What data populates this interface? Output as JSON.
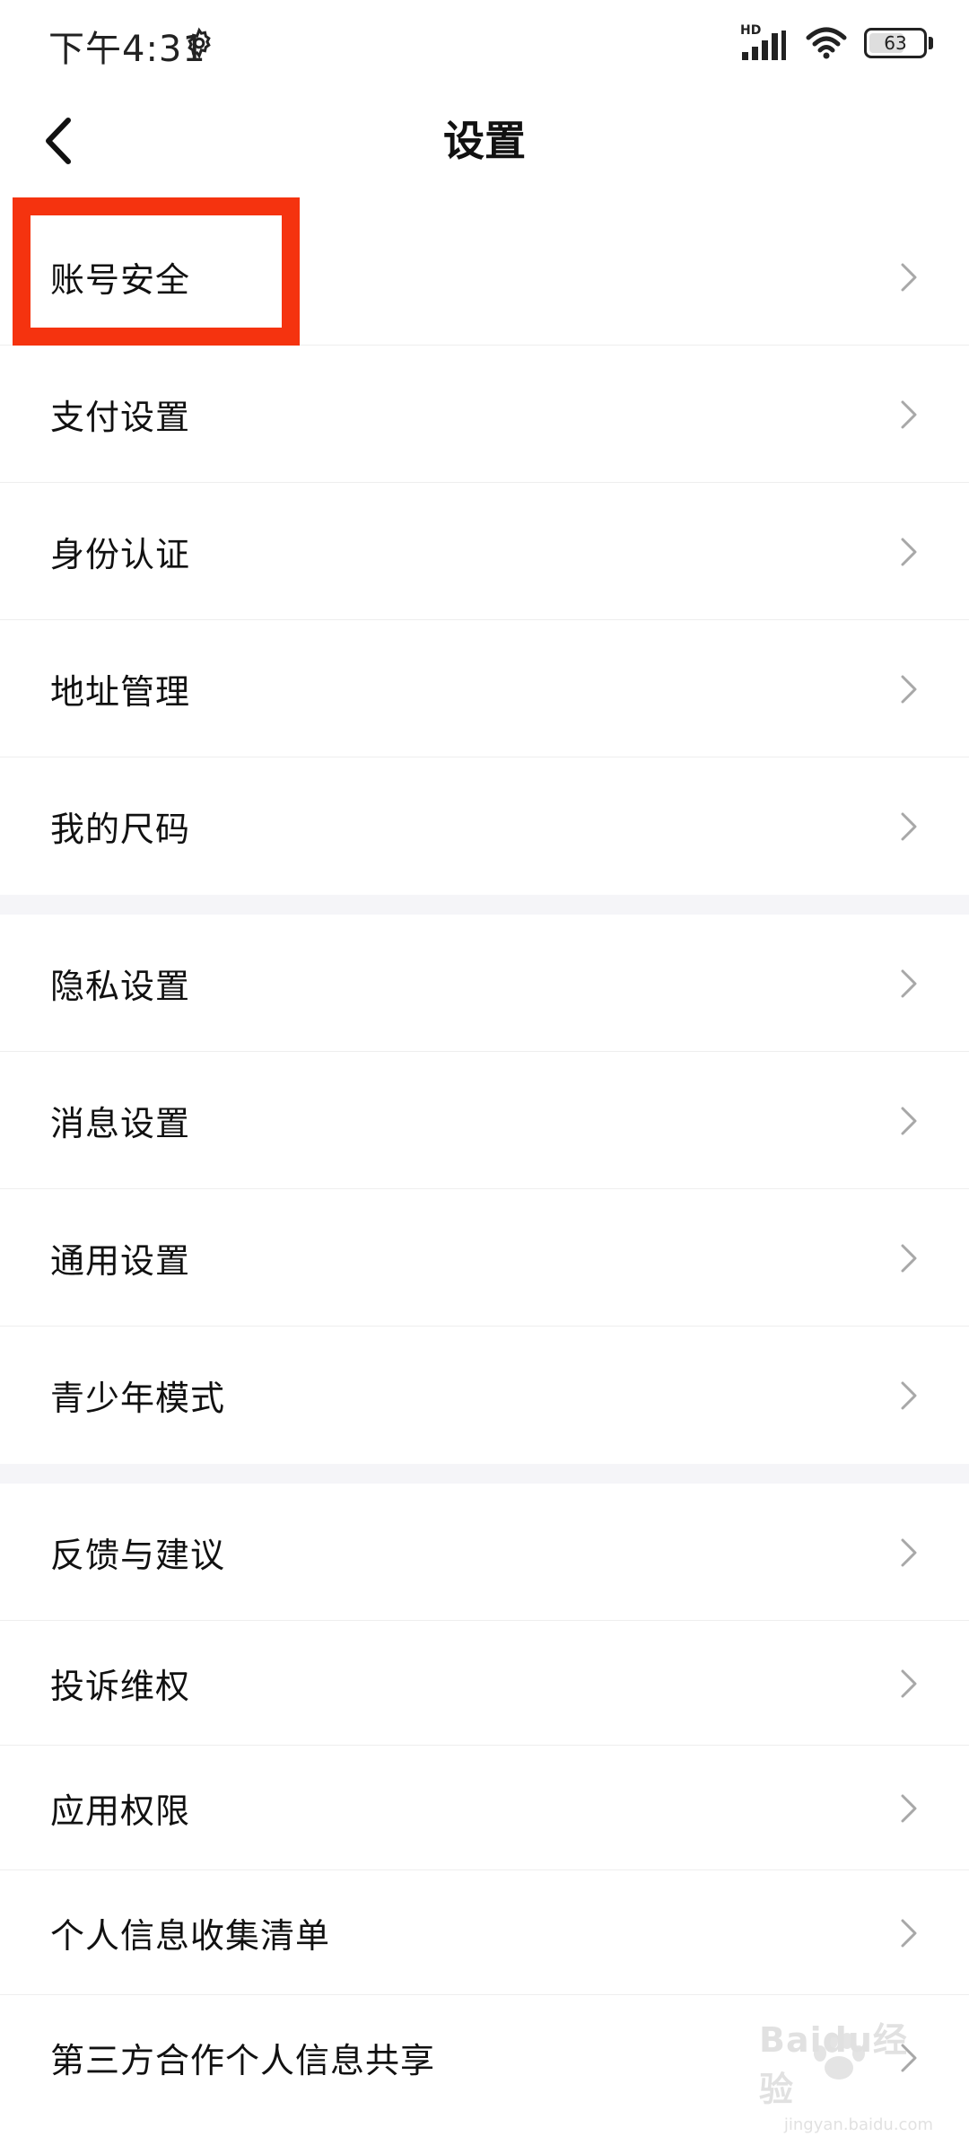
{
  "status_bar": {
    "time": "下午4:31",
    "hd_label": "HD",
    "battery_level": "63"
  },
  "header": {
    "title": "设置"
  },
  "groups": [
    {
      "items": [
        {
          "label": "账号安全"
        },
        {
          "label": "支付设置"
        },
        {
          "label": "身份认证"
        },
        {
          "label": "地址管理"
        },
        {
          "label": "我的尺码"
        }
      ]
    },
    {
      "items": [
        {
          "label": "隐私设置"
        },
        {
          "label": "消息设置"
        },
        {
          "label": "通用设置"
        },
        {
          "label": "青少年模式"
        }
      ]
    },
    {
      "items": [
        {
          "label": "反馈与建议"
        },
        {
          "label": "投诉维权"
        },
        {
          "label": "应用权限"
        },
        {
          "label": "个人信息收集清单"
        },
        {
          "label": "第三方合作个人信息共享"
        }
      ]
    }
  ],
  "annotation": {
    "highlight_color": "#f5330f"
  },
  "watermark": {
    "text": "Baidu经验",
    "url": "jingyan.baidu.com"
  }
}
